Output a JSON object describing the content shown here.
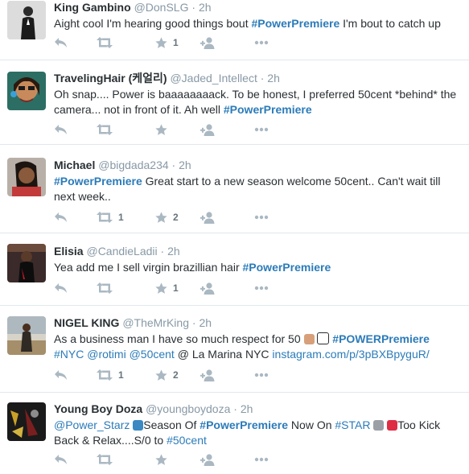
{
  "tweets": [
    {
      "fullname": "King Gambino",
      "handle": "@DonSLG",
      "sep": "·",
      "time": "2h",
      "segments": [
        {
          "t": "Aight cool I'm hearing good things bout "
        },
        {
          "t": "#PowerPremiere",
          "link": true,
          "bold": true
        },
        {
          "t": " I'm bout to catch up"
        }
      ],
      "retweets": "",
      "favorites": "1"
    },
    {
      "fullname": "TravelingHair (케얼리)",
      "handle": "@Jaded_Intellect",
      "sep": "·",
      "time": "2h",
      "segments": [
        {
          "t": "Oh snap.... Power is baaaaaaaack. To be honest, I preferred 50cent *behind* the camera... not in front of it. Ah well "
        },
        {
          "t": "#PowerPremiere",
          "link": true,
          "bold": true
        }
      ],
      "retweets": "",
      "favorites": ""
    },
    {
      "fullname": "Michael",
      "handle": "@bigdada234",
      "sep": "·",
      "time": "2h",
      "segments": [
        {
          "t": "#PowerPremiere",
          "link": true,
          "bold": true
        },
        {
          "t": " Great start to a new season welcome 50cent.. Can't wait till next week.."
        }
      ],
      "retweets": "1",
      "favorites": "2"
    },
    {
      "fullname": "Elisia",
      "handle": "@CandieLadii",
      "sep": "·",
      "time": "2h",
      "segments": [
        {
          "t": "Yea add me I sell virgin brazillian hair "
        },
        {
          "t": "#PowerPremiere",
          "link": true,
          "bold": true
        }
      ],
      "retweets": "",
      "favorites": "1"
    },
    {
      "fullname": "NIGEL KING",
      "handle": "@TheMrKing",
      "sep": "·",
      "time": "2h",
      "segments": [
        {
          "t": "As a business man I have so much respect for 50 "
        },
        {
          "t": "",
          "emoji": "#d8a07a"
        },
        {
          "t": " "
        },
        {
          "t": "",
          "emoji": "#ffffff",
          "box": true
        },
        {
          "t": " "
        },
        {
          "t": "#POWERPremiere",
          "link": true,
          "bold": true
        },
        {
          "t": " "
        },
        {
          "t": "#NYC",
          "link": true
        },
        {
          "t": "  "
        },
        {
          "t": "@rotimi",
          "link": true
        },
        {
          "t": " "
        },
        {
          "t": "@50cent",
          "link": true
        },
        {
          "t": " @ La Marina NYC "
        },
        {
          "t": "instagram.com/p/3pBXBpyguR/",
          "link": true
        }
      ],
      "retweets": "1",
      "favorites": "2"
    },
    {
      "fullname": "Young Boy Doza",
      "handle": "@youngboydoza",
      "sep": "·",
      "time": "2h",
      "segments": [
        {
          "t": "@Power_Starz",
          "link": true
        },
        {
          "t": " "
        },
        {
          "t": "",
          "emoji": "#3b88c3"
        },
        {
          "t": "Season Of "
        },
        {
          "t": "#PowerPremiere",
          "link": true,
          "bold": true
        },
        {
          "t": " Now On "
        },
        {
          "t": "#STAR",
          "link": true
        },
        {
          "t": " "
        },
        {
          "t": "",
          "emoji": "#9aa0a6"
        },
        {
          "t": " "
        },
        {
          "t": "",
          "emoji": "#dd2e44"
        },
        {
          "t": "Too Kick Back & Relax....S/0 to "
        },
        {
          "t": "#50cent",
          "link": true
        }
      ],
      "retweets": "",
      "favorites": ""
    }
  ],
  "colors": {
    "link": "#2b7bb9",
    "icon": "#aab8c2",
    "divider": "#e1e8ed"
  },
  "icons": [
    "reply-icon",
    "retweet-icon",
    "favorite-star-icon",
    "follow-user-icon",
    "more-dots-icon"
  ]
}
